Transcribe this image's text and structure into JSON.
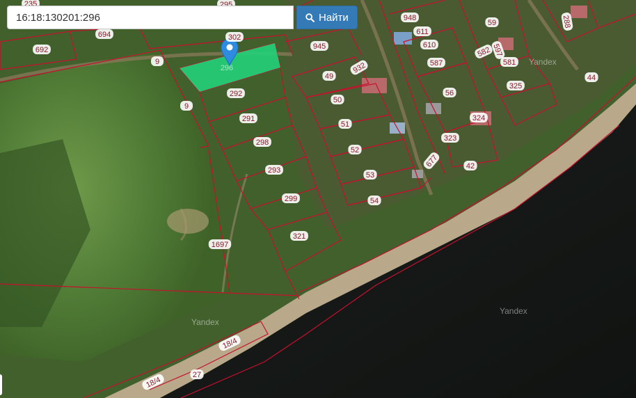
{
  "search": {
    "value": "16:18:130201:296",
    "button_label": "Найти",
    "button_icon": "search-icon"
  },
  "map": {
    "selected_parcel": "296",
    "marker_icon": "map-pin-icon",
    "highlight_color": "#22d07a",
    "boundary_color": "#c8102e",
    "watermark": "Yandex",
    "parcel_labels": [
      "235",
      "295",
      "694",
      "692",
      "302",
      "945",
      "9",
      "9",
      "292",
      "291",
      "298",
      "293",
      "299",
      "321",
      "1697",
      "49",
      "932",
      "50",
      "51",
      "52",
      "53",
      "54",
      "948",
      "611",
      "610",
      "587",
      "56",
      "59",
      "582",
      "597",
      "581",
      "325",
      "288",
      "324",
      "323",
      "677",
      "42",
      "44",
      "18/4",
      "18/4",
      "27"
    ]
  }
}
